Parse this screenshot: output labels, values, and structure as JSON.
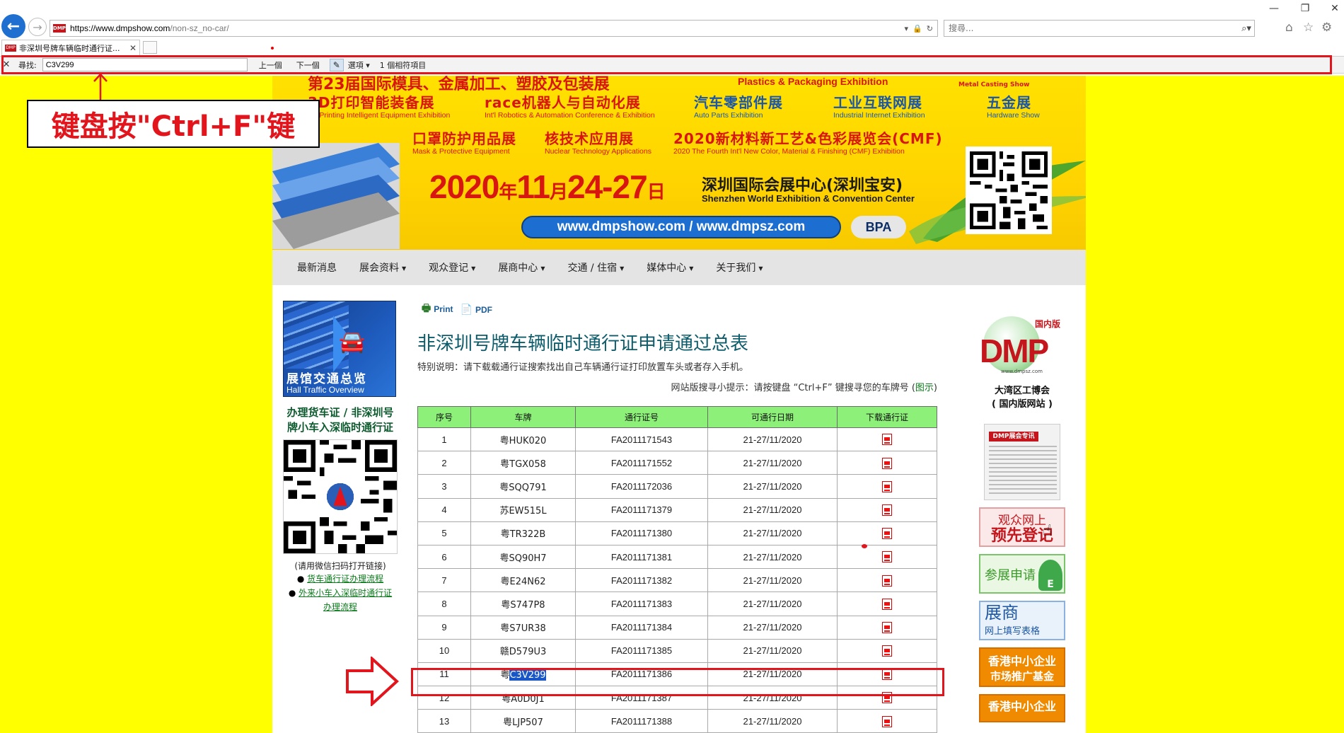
{
  "browser": {
    "url_host": "https://www.dmpshow.com",
    "url_path": "/non-sz_no-car/",
    "search_placeholder": "搜尋...",
    "tab_title": "非深圳号牌车辆临时通行证...",
    "favicon_text": "DMP"
  },
  "find_bar": {
    "label": "尋找:",
    "query": "C3V299",
    "prev": "上一個",
    "next": "下一個",
    "options": "選項 ▾",
    "count": "1 個相符項目"
  },
  "annotation": {
    "text": "键盘按\"Ctrl+F\"键",
    "colors": {
      "annotation_red": "#e2141c"
    }
  },
  "banner": {
    "top_cn": "第23届国际模具、金属加工、塑胶及包装展",
    "top_en": "Plastics & Packaging Exhibition",
    "top_logo": "Metal Casting Show",
    "exhibitions": [
      {
        "cn": "3D打印智能装备展",
        "en": "3D Printing Intelligent Equipment Exhibition"
      },
      {
        "cn": "race机器人与自动化展",
        "en": "Int'l Robotics & Automation Conference & Exhibition"
      },
      {
        "cn": "汽车零部件展",
        "en": "Auto  Parts  Exhibition"
      },
      {
        "cn": "工业互联网展",
        "en": "Industrial Internet Exhibition"
      },
      {
        "cn": "五金展",
        "en": "Hardware Show"
      },
      {
        "cn": "口罩防护用品展",
        "en": "Mask & Protective Equipment"
      },
      {
        "cn": "核技术应用展",
        "en": "Nuclear Technology Applications"
      },
      {
        "cn": "2020新材料新工艺&色彩展览会(CMF)",
        "en": "2020 The Fourth Int'l New Color, Material & Finishing (CMF) Exhibition"
      }
    ],
    "date_a": "2020",
    "date_b": "年",
    "date_c": "11",
    "date_d": "月",
    "date_e": "24-27",
    "date_f": "日",
    "venue_cn": "深圳国际会展中心(深圳宝安)",
    "venue_en": "Shenzhen World Exhibition & Convention Center",
    "website": "www.dmpshow.com / www.dmpsz.com",
    "bpa": "BPA"
  },
  "nav": [
    "最新消息",
    "展会资料",
    "观众登记",
    "展商中心",
    "交通 / 住宿",
    "媒体中心",
    "关于我们"
  ],
  "nav_has_caret": [
    false,
    true,
    true,
    true,
    true,
    true,
    true
  ],
  "left_sidebar": {
    "hall_cn": "展馆交通总览",
    "hall_en": "Hall  Traffic  Overview",
    "permit_heading_1": "办理货车证 / 非深圳号",
    "permit_heading_2": "牌小车入深临时通行证",
    "wechat_caption": "(请用微信扫码打开链接)",
    "link_1": "货车通行证办理流程",
    "link_2": "外来小车入深临时通行证办理流程"
  },
  "main": {
    "print": "Print",
    "pdf": "PDF",
    "title": "非深圳号牌车辆临时通行证申请通过总表",
    "note": "特别说明：请下载载通行证搜索找出自己车辆通行证打印放置车头或者存入手机。",
    "tip_prefix": "网站版搜寻小提示：请按键盘 “Ctrl+F” 键搜寻您的车牌号 (",
    "tip_link": "图示",
    "tip_suffix": ")",
    "columns": [
      "序号",
      "车牌",
      "通行证号",
      "可通行日期",
      "下载通行证"
    ]
  },
  "table_rows": [
    {
      "no": "1",
      "plate_prefix": "粤HUK020",
      "plate_hl": "",
      "permit": "FA2011171543",
      "dates": "21-27/11/2020"
    },
    {
      "no": "2",
      "plate_prefix": "粤TGX058",
      "plate_hl": "",
      "permit": "FA2011171552",
      "dates": "21-27/11/2020"
    },
    {
      "no": "3",
      "plate_prefix": "粤SQQ791",
      "plate_hl": "",
      "permit": "FA2011172036",
      "dates": "21-27/11/2020"
    },
    {
      "no": "4",
      "plate_prefix": "苏EW515L",
      "plate_hl": "",
      "permit": "FA2011171379",
      "dates": "21-27/11/2020"
    },
    {
      "no": "5",
      "plate_prefix": "粤TR322B",
      "plate_hl": "",
      "permit": "FA2011171380",
      "dates": "21-27/11/2020"
    },
    {
      "no": "6",
      "plate_prefix": "粤SQ90H7",
      "plate_hl": "",
      "permit": "FA2011171381",
      "dates": "21-27/11/2020"
    },
    {
      "no": "7",
      "plate_prefix": "粤E24N62",
      "plate_hl": "",
      "permit": "FA2011171382",
      "dates": "21-27/11/2020"
    },
    {
      "no": "8",
      "plate_prefix": "粤S747P8",
      "plate_hl": "",
      "permit": "FA2011171383",
      "dates": "21-27/11/2020"
    },
    {
      "no": "9",
      "plate_prefix": "粤S7UR38",
      "plate_hl": "",
      "permit": "FA2011171384",
      "dates": "21-27/11/2020"
    },
    {
      "no": "10",
      "plate_prefix": "赣D579U3",
      "plate_hl": "",
      "permit": "FA2011171385",
      "dates": "21-27/11/2020"
    },
    {
      "no": "11",
      "plate_prefix": "粤",
      "plate_hl": "C3V299",
      "permit": "FA2011171386",
      "dates": "21-27/11/2020"
    },
    {
      "no": "12",
      "plate_prefix": "粤A0D0J1",
      "plate_hl": "",
      "permit": "FA2011171387",
      "dates": "21-27/11/2020"
    },
    {
      "no": "13",
      "plate_prefix": "粤LJP507",
      "plate_hl": "",
      "permit": "FA2011171388",
      "dates": "21-27/11/2020"
    }
  ],
  "right_sidebar": {
    "dmp_tag": "国内版",
    "dmp_text": "DMP",
    "dmp_site": "www.dmpsz.com",
    "gba_1": "大湾区工博会",
    "gba_2": "( 国内版网站 )",
    "newspaper": "DMP展会专讯",
    "visitor_1": "观众网上",
    "visitor_2": "预先登记",
    "exhibit": "参展申请",
    "exhibit_e": "E",
    "exhibitor_1": "展商",
    "exhibitor_2": "网上填写表格",
    "fund_1": "香港中小企业",
    "fund_2": "市场推广基金",
    "fund2_1": "香港中小企业"
  }
}
